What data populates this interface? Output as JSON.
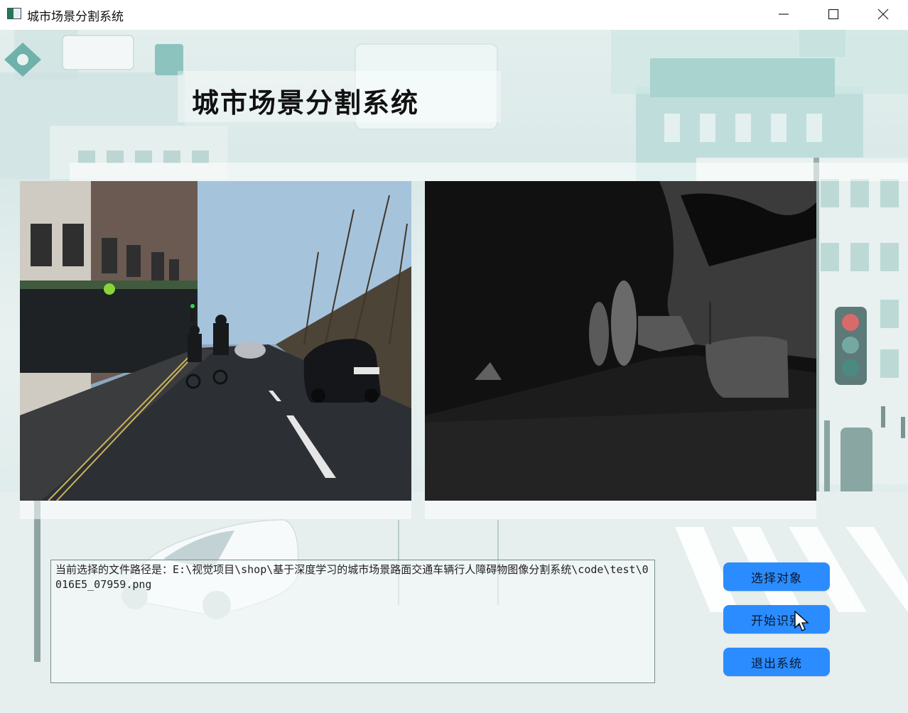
{
  "window": {
    "title": "城市场景分割系统"
  },
  "header": {
    "title": "城市场景分割系统"
  },
  "panels": {
    "original_image": "city-street-scene",
    "segmentation_result": "segmentation-mask"
  },
  "log": {
    "text": "当前选择的文件路径是：E:\\视觉项目\\shop\\基于深度学习的城市场景路面交通车辆行人障碍物图像分割系统\\code\\test\\0016E5_07959.png"
  },
  "buttons": {
    "select": "选择对象",
    "start": "开始识别",
    "exit": "退出系统"
  },
  "colors": {
    "button": "#2b8cff",
    "accent": "#5fa7a3"
  }
}
